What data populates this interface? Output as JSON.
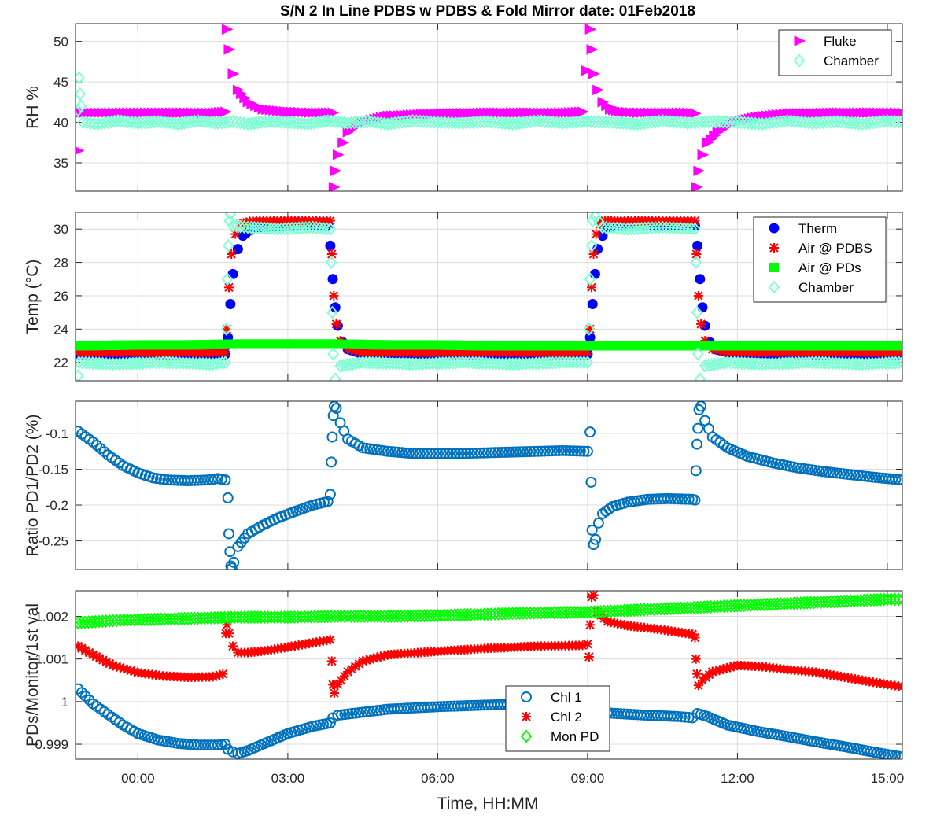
{
  "title": "S/N 2 In Line PDBS w PDBS & Fold Mirror date: 01Feb2018",
  "x_axis": {
    "label": "Time, HH:MM",
    "unit": "hours relative to 00:00",
    "range": [
      -1.25,
      15.3
    ],
    "ticks": [
      {
        "value": 0,
        "label": "00:00"
      },
      {
        "value": 3,
        "label": "03:00"
      },
      {
        "value": 6,
        "label": "06:00"
      },
      {
        "value": 9,
        "label": "09:00"
      },
      {
        "value": 12,
        "label": "12:00"
      },
      {
        "value": 15,
        "label": "15:00"
      }
    ]
  },
  "chart_data": [
    {
      "id": "rh",
      "type": "scatter",
      "ylabel": "RH %",
      "ylim": [
        31.5,
        52.2
      ],
      "yticks": [
        35,
        40,
        45,
        50
      ],
      "ytick_labels": [
        "35",
        "40",
        "45",
        "50"
      ],
      "grid": true,
      "legend": "top-right",
      "series": [
        {
          "name": "Fluke",
          "marker": "triangle-right",
          "color": "#ff00ff",
          "x": [
            -1.2,
            -1.15,
            -0.5,
            0,
            0.5,
            1,
            1.5,
            1.75,
            1.78,
            1.82,
            1.9,
            2,
            2.2,
            2.5,
            3,
            3.5,
            3.9,
            3.92,
            3.95,
            4,
            4.1,
            4.2,
            4.35,
            4.6,
            5,
            6,
            7,
            8,
            8.5,
            8.9,
            9.05,
            9.08,
            9.12,
            9.2,
            9.3,
            9.45,
            9.7,
            10,
            10.5,
            11,
            11.15,
            11.18,
            11.22,
            11.3,
            11.4,
            11.6,
            11.9,
            12.5,
            13,
            14,
            15,
            15.3
          ],
          "y": [
            36.5,
            41.2,
            41.2,
            41.2,
            41.2,
            41.2,
            41.2,
            41.3,
            51.5,
            49,
            46,
            44,
            42.5,
            41.6,
            41.3,
            41.2,
            41.2,
            32,
            34,
            36,
            37.5,
            38.8,
            39.6,
            40.2,
            40.8,
            41.1,
            41.2,
            41.2,
            41.2,
            41.3,
            51.5,
            49,
            46,
            44,
            42.5,
            41.6,
            41.3,
            41.2,
            41.2,
            41.2,
            41.1,
            32,
            34,
            36,
            37.5,
            38.8,
            40,
            40.8,
            41.1,
            41.2,
            41.2,
            41.2
          ]
        },
        {
          "name": "Chamber",
          "marker": "diamond",
          "color": "#7fffd4",
          "x": [
            -1.2,
            -1.18,
            -1.16,
            -1.14,
            -1.1,
            -0.8,
            -0.4,
            0,
            0.4,
            0.8,
            1.2,
            1.6,
            1.9,
            2.2,
            2.6,
            3,
            3.4,
            3.8,
            4.2,
            4.6,
            5,
            5.5,
            6,
            6.5,
            7,
            7.5,
            8,
            8.5,
            9,
            9.5,
            10,
            10.5,
            11,
            11.5,
            12,
            12.5,
            13,
            13.5,
            14,
            14.5,
            15,
            15.3
          ],
          "y": [
            41.5,
            45.5,
            43.5,
            42,
            40,
            39.8,
            40.2,
            39.9,
            40.1,
            39.8,
            40.2,
            39.9,
            40.1,
            39.8,
            40.1,
            40,
            39.8,
            40.2,
            39.9,
            40.1,
            39.8,
            40.2,
            40,
            39.9,
            40.1,
            39.8,
            40.2,
            39.9,
            40.1,
            40,
            39.8,
            40.2,
            39.9,
            40.1,
            40,
            39.8,
            40.2,
            39.9,
            40.1,
            39.8,
            40.2,
            40
          ]
        }
      ]
    },
    {
      "id": "temp",
      "type": "scatter",
      "ylabel": "Temp (°C)",
      "ylim": [
        20.9,
        31.0
      ],
      "yticks": [
        22,
        24,
        26,
        28,
        30
      ],
      "ytick_labels": [
        "22",
        "24",
        "26",
        "28",
        "30"
      ],
      "grid": true,
      "legend": "top-right",
      "series": [
        {
          "name": "Therm",
          "marker": "circle-filled",
          "color": "#0000ff",
          "x": [
            -1.2,
            0,
            1.5,
            1.75,
            1.8,
            1.85,
            1.9,
            2,
            2.1,
            2.3,
            3,
            3.8,
            3.85,
            3.9,
            3.95,
            4,
            4.1,
            4.2,
            4.4,
            6,
            8,
            9,
            9.05,
            9.1,
            9.15,
            9.2,
            9.3,
            9.4,
            9.6,
            10.5,
            11.15,
            11.2,
            11.25,
            11.3,
            11.35,
            11.45,
            11.55,
            11.8,
            13,
            15.3
          ],
          "y": [
            22.5,
            22.5,
            22.5,
            22.5,
            23.5,
            25.5,
            27.3,
            28.8,
            29.6,
            30.1,
            30.2,
            30.2,
            29,
            27,
            25.3,
            24.2,
            23.2,
            22.8,
            22.6,
            22.5,
            22.5,
            22.5,
            23.5,
            25.5,
            27.3,
            28.8,
            29.6,
            30.1,
            30.2,
            30.2,
            30.2,
            29,
            27,
            25.3,
            24.2,
            23.2,
            22.8,
            22.6,
            22.5,
            22.5
          ]
        },
        {
          "name": "Air @ PDBS",
          "marker": "asterisk",
          "color": "#ff0000",
          "x": [
            -1.2,
            0,
            1.5,
            1.75,
            1.78,
            1.82,
            1.87,
            1.95,
            2.05,
            2.3,
            3,
            3.85,
            3.88,
            3.92,
            3.97,
            4.05,
            4.2,
            4.5,
            6,
            8,
            9,
            9.05,
            9.08,
            9.12,
            9.17,
            9.25,
            9.35,
            9.6,
            10.5,
            11.15,
            11.18,
            11.22,
            11.27,
            11.35,
            11.5,
            11.8,
            13,
            15.3
          ],
          "y": [
            22.6,
            22.6,
            22.6,
            22.6,
            24,
            26.5,
            28.5,
            29.7,
            30.3,
            30.5,
            30.5,
            30.5,
            28.5,
            26,
            24.3,
            23.3,
            22.8,
            22.6,
            22.6,
            22.6,
            22.6,
            24,
            26.5,
            28.5,
            29.7,
            30.3,
            30.5,
            30.5,
            30.5,
            30.5,
            28.5,
            26,
            24.3,
            23.3,
            22.8,
            22.6,
            22.6,
            22.6
          ]
        },
        {
          "name": "Air @ PDs",
          "marker": "square-filled",
          "color": "#00ff00",
          "x": [
            -1.2,
            0,
            1,
            2,
            3,
            4,
            5,
            6,
            7,
            8,
            9,
            10,
            11,
            12,
            13,
            14,
            15,
            15.3
          ],
          "y": [
            23.0,
            23.05,
            23.05,
            23.1,
            23.1,
            23.1,
            23.05,
            23.05,
            23.0,
            23.0,
            23.0,
            23.0,
            23.0,
            23.0,
            23.0,
            23.0,
            23.0,
            23.0
          ]
        },
        {
          "name": "Chamber",
          "marker": "diamond",
          "color": "#7fffd4",
          "x": [
            -1.2,
            -1.18,
            -0.5,
            0.5,
            1.5,
            1.75,
            1.77,
            1.79,
            1.81,
            1.83,
            1.85,
            1.9,
            2.2,
            2.8,
            3.5,
            3.85,
            3.87,
            3.89,
            3.91,
            3.95,
            4.05,
            4.5,
            5.5,
            6.5,
            7.5,
            8.5,
            9,
            9.03,
            9.05,
            9.08,
            9.1,
            9.15,
            9.3,
            9.8,
            10.5,
            11.15,
            11.17,
            11.19,
            11.21,
            11.25,
            11.35,
            11.8,
            12.5,
            13.5,
            14.5,
            15.3
          ],
          "y": [
            21.2,
            22.0,
            21.9,
            22.0,
            21.9,
            22.0,
            24,
            27,
            29,
            30.5,
            30.9,
            30.2,
            30.1,
            30.0,
            30.1,
            30.0,
            28,
            25,
            22.5,
            21.0,
            21.8,
            22.0,
            21.9,
            22.0,
            21.9,
            22.0,
            22.0,
            24,
            27,
            29,
            30.5,
            30.8,
            30.1,
            30.0,
            30.1,
            30.0,
            28,
            25,
            22.5,
            21.0,
            21.8,
            22.0,
            21.9,
            22.0,
            21.9,
            22.0
          ]
        }
      ]
    },
    {
      "id": "ratio",
      "type": "scatter",
      "ylabel": "Ratio PD1/PD2 (%)",
      "ylim": [
        -0.29,
        -0.055
      ],
      "yticks": [
        -0.25,
        -0.2,
        -0.15,
        -0.1
      ],
      "ytick_labels": [
        "-0.25",
        "-0.2",
        "-0.15",
        "-0.1"
      ],
      "grid": true,
      "legend": "none",
      "series": [
        {
          "name": "",
          "marker": "circle-open",
          "color": "#0072bd",
          "x": [
            -1.2,
            -0.9,
            -0.6,
            -0.3,
            0,
            0.3,
            0.6,
            1,
            1.4,
            1.6,
            1.75,
            1.8,
            1.82,
            1.84,
            1.86,
            1.88,
            1.92,
            2,
            2.2,
            2.5,
            2.8,
            3.1,
            3.5,
            3.8,
            3.85,
            3.87,
            3.89,
            3.91,
            3.93,
            3.97,
            4.05,
            4.2,
            4.5,
            5,
            5.5,
            6,
            6.5,
            7,
            7.5,
            8,
            8.5,
            9.0,
            9.05,
            9.07,
            9.09,
            9.12,
            9.16,
            9.22,
            9.3,
            9.5,
            9.8,
            10.2,
            10.6,
            11.1,
            11.15,
            11.17,
            11.19,
            11.21,
            11.23,
            11.27,
            11.35,
            11.5,
            11.8,
            12.2,
            12.7,
            13.2,
            13.7,
            14.2,
            14.7,
            15.3
          ],
          "y": [
            -0.097,
            -0.112,
            -0.13,
            -0.145,
            -0.155,
            -0.162,
            -0.165,
            -0.166,
            -0.165,
            -0.163,
            -0.165,
            -0.19,
            -0.24,
            -0.265,
            -0.285,
            -0.288,
            -0.28,
            -0.258,
            -0.24,
            -0.228,
            -0.218,
            -0.21,
            -0.2,
            -0.195,
            -0.185,
            -0.14,
            -0.105,
            -0.075,
            -0.062,
            -0.065,
            -0.085,
            -0.108,
            -0.12,
            -0.125,
            -0.128,
            -0.128,
            -0.128,
            -0.127,
            -0.126,
            -0.125,
            -0.124,
            -0.125,
            -0.098,
            -0.168,
            -0.235,
            -0.255,
            -0.248,
            -0.225,
            -0.212,
            -0.202,
            -0.196,
            -0.192,
            -0.191,
            -0.192,
            -0.193,
            -0.152,
            -0.115,
            -0.093,
            -0.067,
            -0.062,
            -0.082,
            -0.105,
            -0.12,
            -0.132,
            -0.141,
            -0.148,
            -0.153,
            -0.157,
            -0.161,
            -0.165
          ]
        }
      ]
    },
    {
      "id": "pds",
      "type": "scatter",
      "ylabel": "PDs/Monitor/1st val",
      "ylim": [
        0.99865,
        1.0026
      ],
      "yticks": [
        0.999,
        1.0,
        1.001,
        1.002
      ],
      "ytick_labels": [
        "0.999",
        "1",
        "1.001",
        "1.002"
      ],
      "grid": true,
      "legend": "bottom-center",
      "series": [
        {
          "name": "Chl 1",
          "marker": "circle-open",
          "color": "#0072bd",
          "x": [
            -1.2,
            -0.9,
            -0.6,
            -0.3,
            0,
            0.4,
            0.8,
            1.2,
            1.6,
            1.75,
            1.8,
            1.9,
            2.0,
            2.2,
            2.6,
            3.0,
            3.5,
            3.85,
            3.9,
            4.0,
            4.5,
            5,
            6,
            7,
            8,
            8.8,
            9.05,
            9.2,
            9.6,
            10.2,
            10.8,
            11.1,
            11.2,
            11.4,
            11.8,
            12.4,
            13,
            13.6,
            14.2,
            14.8,
            15.3
          ],
          "y": [
            1.0003,
            0.99995,
            0.9997,
            0.99945,
            0.99925,
            0.9991,
            0.99902,
            0.99898,
            0.99898,
            0.999,
            0.99888,
            0.99882,
            0.99878,
            0.99885,
            0.99905,
            0.99925,
            0.99942,
            0.9995,
            0.99962,
            0.99968,
            0.99975,
            0.99982,
            0.99988,
            0.99992,
            0.99995,
            0.99995,
            0.99975,
            0.99975,
            0.99972,
            0.99968,
            0.99965,
            0.99962,
            0.99972,
            0.99965,
            0.99945,
            0.9993,
            0.99918,
            0.99905,
            0.99893,
            0.9988,
            0.9987
          ]
        },
        {
          "name": "Chl 2",
          "marker": "asterisk",
          "color": "#ff0000",
          "x": [
            -1.2,
            -0.9,
            -0.5,
            0,
            0.5,
            1,
            1.5,
            1.7,
            1.76,
            1.78,
            1.82,
            1.9,
            2.0,
            2.2,
            2.6,
            3.0,
            3.5,
            3.85,
            3.88,
            3.9,
            3.93,
            4.0,
            4.2,
            4.5,
            5,
            6,
            7,
            8,
            8.9,
            9.0,
            9.03,
            9.05,
            9.08,
            9.12,
            9.2,
            9.4,
            9.8,
            10.4,
            11.1,
            11.15,
            11.17,
            11.19,
            11.22,
            11.3,
            11.5,
            12,
            12.5,
            13,
            13.5,
            14,
            14.5,
            15,
            15.3
          ],
          "y": [
            1.0013,
            1.0011,
            1.00085,
            1.00068,
            1.0006,
            1.00057,
            1.00058,
            1.00065,
            1.0016,
            1.0018,
            1.0016,
            1.0013,
            1.00115,
            1.00115,
            1.0012,
            1.00128,
            1.00138,
            1.00145,
            1.00095,
            1.0004,
            1.0002,
            1.0004,
            1.0007,
            1.00095,
            1.0011,
            1.00118,
            1.00125,
            1.0013,
            1.00132,
            1.00135,
            1.00105,
            1.0018,
            1.00245,
            1.0025,
            1.0021,
            1.00188,
            1.00178,
            1.0017,
            1.00158,
            1.0015,
            1.001,
            1.00065,
            1.00038,
            1.0005,
            1.0007,
            1.00085,
            1.00082,
            1.00075,
            1.0007,
            1.0006,
            1.0005,
            1.0004,
            1.00035
          ]
        },
        {
          "name": "Mon PD",
          "marker": "diamond",
          "color": "#00ff00",
          "x": [
            -1.2,
            -0.5,
            0,
            1,
            2,
            3,
            4,
            5,
            6,
            7,
            7.5,
            8,
            9,
            10,
            11,
            12,
            13,
            14,
            15,
            15.3
          ],
          "y": [
            1.00185,
            1.0019,
            1.00192,
            1.00195,
            1.00198,
            1.00198,
            1.002,
            1.002,
            1.00202,
            1.00205,
            1.00207,
            1.00208,
            1.0021,
            1.00215,
            1.0022,
            1.00225,
            1.0023,
            1.00235,
            1.0024,
            1.0024
          ]
        }
      ]
    }
  ]
}
